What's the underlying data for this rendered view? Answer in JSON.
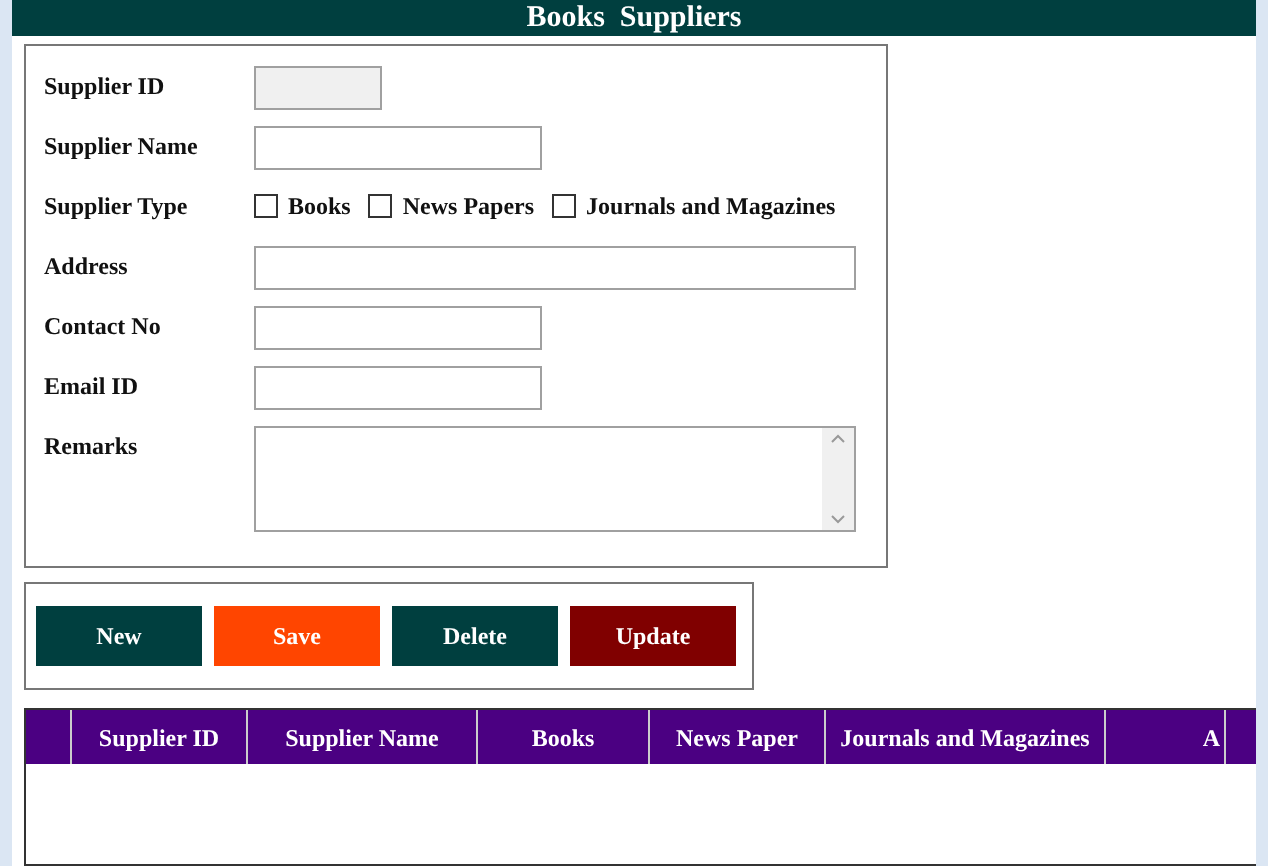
{
  "window": {
    "title": "Books  Suppliers"
  },
  "form": {
    "fields": [
      {
        "kind": "short",
        "label": "Supplier ID",
        "disabled": true
      },
      {
        "kind": "medium",
        "label": "Supplier Name",
        "disabled": false
      },
      {
        "kind": "checks",
        "label": "Supplier Type",
        "options": [
          {
            "label": "Books",
            "checked": false
          },
          {
            "label": "News Papers",
            "checked": false
          },
          {
            "label": "Journals and Magazines",
            "checked": false
          }
        ]
      },
      {
        "kind": "long",
        "label": "Address",
        "disabled": false
      },
      {
        "kind": "medium",
        "label": "Contact No",
        "disabled": false
      },
      {
        "kind": "medium",
        "label": "Email ID",
        "disabled": false
      },
      {
        "kind": "memo",
        "label": "Remarks"
      }
    ]
  },
  "buttons": [
    {
      "label": "New",
      "color": "#003f3f"
    },
    {
      "label": "Save",
      "color": "#ff4500"
    },
    {
      "label": "Delete",
      "color": "#003f3f"
    },
    {
      "label": "Update",
      "color": "#800000"
    }
  ],
  "table": {
    "columns": [
      "Supplier ID",
      "Supplier Name",
      "Books",
      "News Paper",
      "Journals and Magazines",
      "A"
    ]
  }
}
